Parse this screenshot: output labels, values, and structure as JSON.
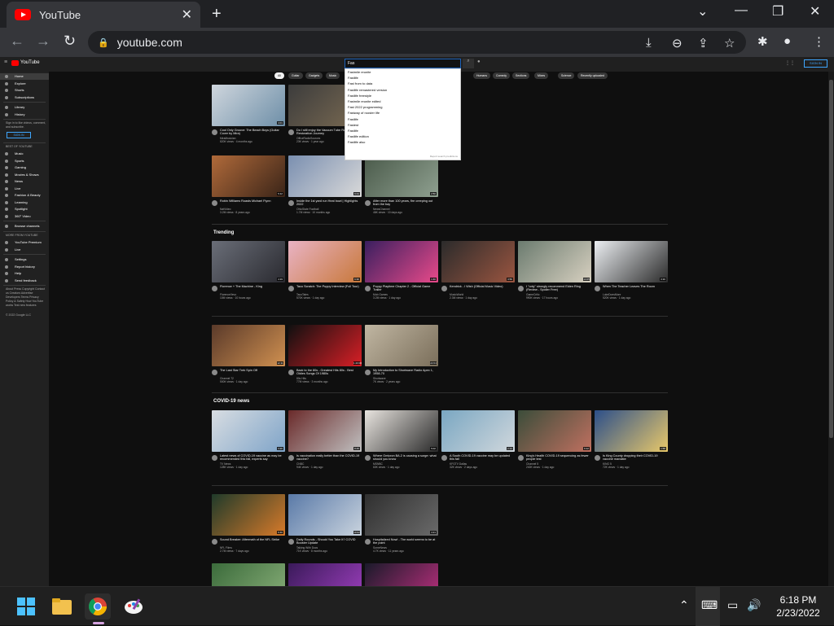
{
  "browser": {
    "tab_title": "YouTube",
    "tab_close": "✕",
    "new_tab": "+",
    "url": "youtube.com",
    "window_controls": [
      "⌄",
      "—",
      "❐",
      "✕"
    ]
  },
  "youtube": {
    "logo_text": "YouTube",
    "search_value": "Fas",
    "sign_in": "SIGN IN",
    "suggestions": [
      "Fastmile reunite",
      "Fastlife",
      "Fast from to data",
      "Fastlife remastered version",
      "Fastlife freestyle",
      "Fastmile reunite edited",
      "Fast 2022 programming",
      "Fastway of rooster life",
      "Fastlife",
      "Fastest",
      "Fastlife",
      "Fastlife edition",
      "Fastlife also"
    ],
    "report_suggestions": "Report search predictions",
    "chips": [
      "All",
      "Guitar",
      "Gadgets",
      "Music",
      "Humans",
      "Comedy",
      "Sections",
      "Mixes",
      "Science",
      "Recently uploaded"
    ],
    "sidebar": {
      "top": [
        "Home",
        "Explore",
        "Shorts",
        "Subscriptions"
      ],
      "library": [
        "Library",
        "History"
      ],
      "signin_text": "Sign in to like videos, comment, and subscribe.",
      "signin_button": "SIGN IN",
      "best_heading": "BEST OF YOUTUBE",
      "best": [
        "Music",
        "Sports",
        "Gaming",
        "Movies & Shows",
        "News",
        "Live",
        "Fashion & Beauty",
        "Learning",
        "Spotlight",
        "360° Video"
      ],
      "browse": "Browse channels",
      "more_heading": "MORE FROM YOUTUBE",
      "more": [
        "YouTube Premium",
        "Live"
      ],
      "settings": [
        "Settings",
        "Report history",
        "Help",
        "Send feedback"
      ],
      "footer": "About Press Copyright Contact us Creators Advertise Developers Terms Privacy Policy & Safety How YouTube works Test new features",
      "copyright": "© 2022 Google LLC"
    },
    "shelves": {
      "trending": "Trending",
      "covid": "COVID-19 news"
    },
    "videos_top": [
      {
        "title": "Cool Only Groove: The Beach Boys (Guitar Cover by Mira)",
        "channel": "MiraMusician",
        "meta": "820K views · 4 months ago",
        "dur": "4:01",
        "c1": "#cfd6dd",
        "c2": "#6e8fa8"
      },
      {
        "title": "Do I still enjoy the Vacuum Tube Radio? My Restoration Journey",
        "channel": "OfficeRadioSources",
        "meta": "23K views · 1 year ago",
        "dur": "18:22",
        "c1": "#3c3c3c",
        "c2": "#7a6a52"
      },
      {
        "title": "Robin Williams Roasts Michael Flynn",
        "channel": "NatVideo",
        "meta": "3.2M views · 8 years ago",
        "dur": "5:12",
        "c1": "#b06a3a",
        "c2": "#3a2418"
      },
      {
        "title": "Inside the 1st yard run Heat bowl | Highlights 2022",
        "channel": "OhioState Football",
        "meta": "1.7M views · 10 months ago",
        "dur": "9:44",
        "c1": "#7a8fb0",
        "c2": "#d9d9d9"
      },
      {
        "title": "After more than 100 years, fire creeping out from the bay",
        "channel": "NewsChannel",
        "meta": "46K views · 10 days ago",
        "dur": "2:50",
        "c1": "#4a5a4a",
        "c2": "#8fa090"
      }
    ],
    "videos_trending": [
      {
        "title": "Florence + The Machine - King",
        "channel": "FlorenceVevo",
        "meta": "10M views · 10 hours ago",
        "dur": "4:19",
        "c1": "#6a6e78",
        "c2": "#2a2a30"
      },
      {
        "title": "Taco Scratch: The Puppy Interview (Full Tour)",
        "channel": "TacoTales",
        "meta": "570K views · 1 day ago",
        "dur": "6:30",
        "c1": "#e9b3c4",
        "c2": "#c8783a"
      },
      {
        "title": "Poppy Playtime Chapter 2 - Official Game Trailer",
        "channel": "Mob Games",
        "meta": "3.2M views · 1 day ago",
        "dur": "1:40",
        "c1": "#3a1f5f",
        "c2": "#e84a8a"
      },
      {
        "title": "Kendrick - I Wish (Official Music Video)",
        "channel": "MusicWorld",
        "meta": "2.3M views · 1 day ago",
        "dur": "3:50",
        "c1": "#2b2b2b",
        "c2": "#9a5540"
      },
      {
        "title": "I \"only\" strongly recommend Elden Ring (Review - Spoiler Free)",
        "channel": "GameCritic",
        "meta": "990K views · 17 hours ago",
        "dur": "14:05",
        "c1": "#6b7b6f",
        "c2": "#d7d0c0"
      },
      {
        "title": "When The Teacher Leaves The Room",
        "channel": "LukeDoesMore",
        "meta": "520K views · 1 day ago",
        "dur": "3:10",
        "c1": "#eceff2",
        "c2": "#2b2b2b"
      }
    ],
    "videos_row3": [
      {
        "title": "The Last Star Trek Spin Off",
        "channel": "Channel 72",
        "meta": "500K views · 1 day ago",
        "dur": "12:11",
        "c1": "#5a3a2a",
        "c2": "#d09050"
      },
      {
        "title": "Back to the 80s - Greatest Hits 80s - Best Oldies Songs Of 1980s",
        "channel": "80s Hits",
        "meta": "77M views · 3 months ago",
        "dur": "1:20:00",
        "c1": "#101010",
        "c2": "#d81f26"
      },
      {
        "title": "My Introduction to Shortwave Radio Apex 1, 1958-70",
        "channel": "Shortwave",
        "meta": "7K views · 2 years ago",
        "dur": "22:04",
        "c1": "#c0b6a2",
        "c2": "#7a6e5a"
      }
    ],
    "videos_covid": [
      {
        "title": "Latest news of COVID-19 vaccine as may be recommended this fall, experts say",
        "channel": "TV News",
        "meta": "128K views · 1 day ago",
        "dur": "3:20",
        "c1": "#d8dde2",
        "c2": "#7fa4c8"
      },
      {
        "title": "Is vaccination really better than the COVID-19 vaccine?",
        "channel": "CNBC",
        "meta": "94K views · 1 day ago",
        "dur": "8:45",
        "c1": "#6a2a2a",
        "c2": "#c0c0c0"
      },
      {
        "title": "Where Omicron BA.2 is causing a surge: what should you know",
        "channel": "MSNBC",
        "meta": "60K views · 1 day ago",
        "dur": "5:02",
        "c1": "#e8e4df",
        "c2": "#2a2a2a"
      },
      {
        "title": "A South COVID-19 vaccine may be updated this fall",
        "channel": "KFGTV Dallas",
        "meta": "32K views · 2 days ago",
        "dur": "2:14",
        "c1": "#7aa7c2",
        "c2": "#d0d7dc"
      },
      {
        "title": "King's Health COVID-19 sequencing as fewer people test",
        "channel": "Channel 5",
        "meta": "240K views · 1 day ago",
        "dur": "6:12",
        "c1": "#3b4d3a",
        "c2": "#c07060"
      },
      {
        "title": "Is King County dropping their COVID-19 vaccine mandate",
        "channel": "KING 5",
        "meta": "72K views · 1 day ago",
        "dur": "1:58",
        "c1": "#2c4f8a",
        "c2": "#e8c86a"
      }
    ],
    "videos_row5": [
      {
        "title": "Sound Breaker: Aftermath of the NFL Strike",
        "channel": "NFL Films",
        "meta": "2.7M views · 7 days ago",
        "dur": "9:40",
        "c1": "#1f3a2a",
        "c2": "#d77a2a"
      },
      {
        "title": "Daily Rounds - Should You Take It? COVID Booster Update",
        "channel": "Talking With Docs",
        "meta": "71K views · 8 months ago",
        "dur": "10:02",
        "c1": "#5a7aa8",
        "c2": "#c9d3de"
      },
      {
        "title": "Hospitalized Now! - The world seems to be at the point",
        "channel": "SomeNews",
        "meta": "4.7K views · 11 years ago",
        "dur": "4:21",
        "c1": "#2f2f2f",
        "c2": "#6a6a6a"
      }
    ],
    "videos_row6": [
      {
        "c1": "#3b6b3b",
        "c2": "#8ab07a"
      },
      {
        "c1": "#3a1a5a",
        "c2": "#a040c0"
      },
      {
        "c1": "#1a1a2a",
        "c2": "#c03080"
      }
    ]
  },
  "taskbar": {
    "time": "6:18 PM",
    "date": "2/23/2022"
  }
}
